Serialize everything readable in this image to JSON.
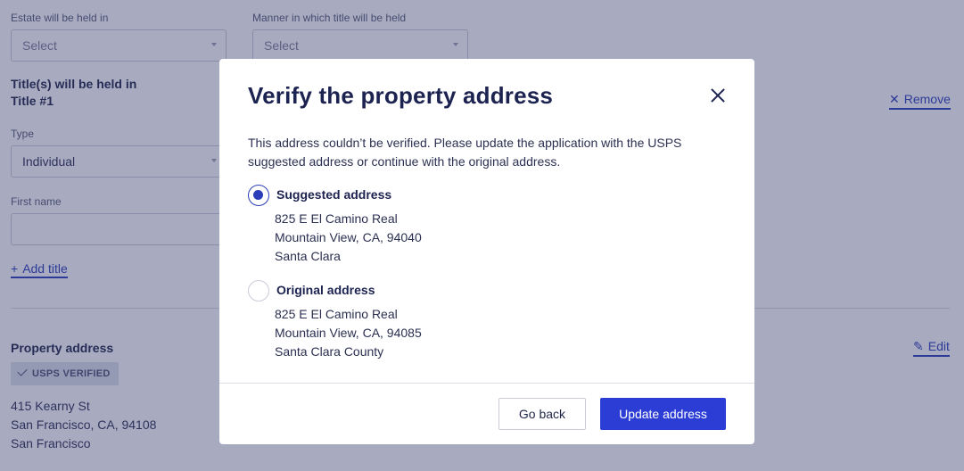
{
  "background": {
    "estate_label": "Estate will be held in",
    "estate_placeholder": "Select",
    "manner_label": "Manner in which title will be held",
    "manner_placeholder": "Select",
    "titles_heading": "Title(s) will be held in",
    "title_name": "Title #1",
    "remove_label": "Remove",
    "type_label": "Type",
    "type_value": "Individual",
    "first_name_label": "First name",
    "add_title_label": "Add title",
    "property_address_heading": "Property address",
    "edit_label": "Edit",
    "verified_badge": "USPS VERIFIED",
    "address_lines": [
      "415 Kearny St",
      "San Francisco, CA, 94108",
      "San Francisco"
    ]
  },
  "modal": {
    "title": "Verify the property address",
    "description": "This address couldn’t be verified. Please update the application with the USPS suggested address or continue with the original address.",
    "options": [
      {
        "title": "Suggested address",
        "selected": true,
        "lines": [
          "825 E El Camino Real",
          "Mountain View, CA, 94040",
          "Santa Clara"
        ]
      },
      {
        "title": "Original address",
        "selected": false,
        "lines": [
          "825 E El Camino Real",
          "Mountain View, CA, 94085",
          "Santa Clara County"
        ]
      }
    ],
    "go_back_label": "Go back",
    "update_label": "Update address"
  },
  "colors": {
    "primary": "#2b3dd4",
    "link": "#2b3db8",
    "text": "#1c2350",
    "overlay": "#303668"
  },
  "icons": {
    "close": "close-icon",
    "remove": "x-icon",
    "add": "plus-icon",
    "edit": "pencil-icon",
    "verified": "check-icon"
  }
}
